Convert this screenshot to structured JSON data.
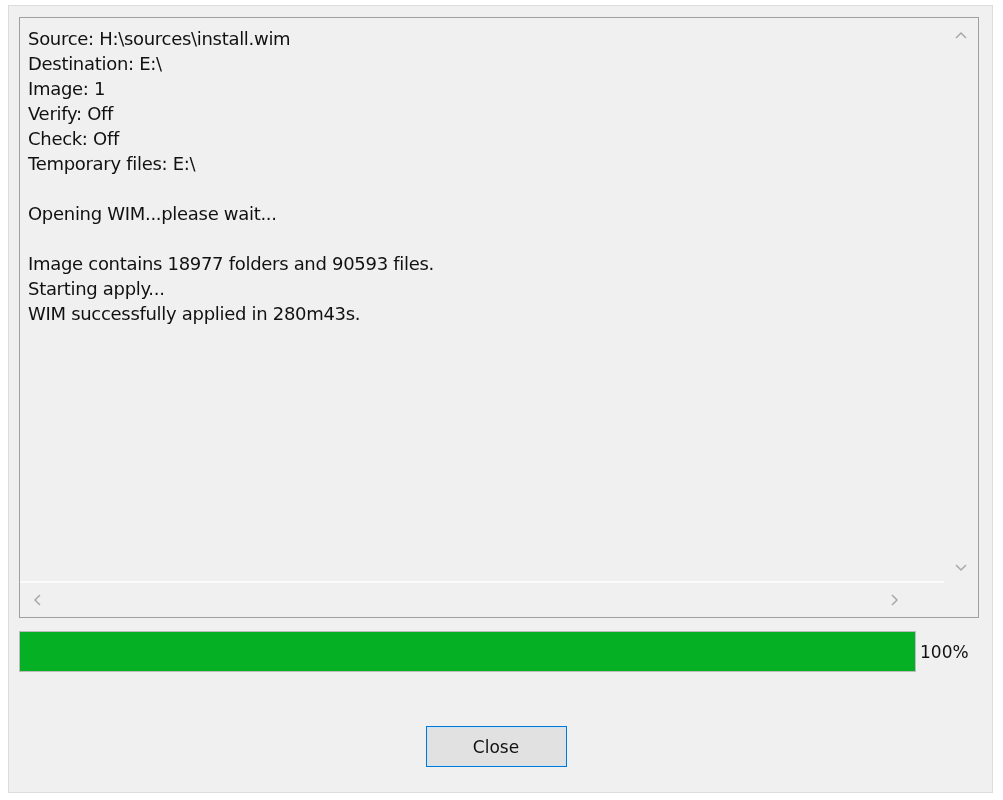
{
  "log": {
    "groups": [
      [
        "Source: H:\\sources\\install.wim",
        "Destination: E:\\",
        "Image: 1",
        "Verify: Off",
        "Check: Off",
        "Temporary files: E:\\"
      ],
      [
        "Opening WIM...please wait..."
      ],
      [
        "Image contains 18977 folders and 90593 files.",
        "Starting apply...",
        "WIM successfully applied in 280m43s."
      ]
    ]
  },
  "progress": {
    "level": 1,
    "reading": "100%"
  },
  "buttons": [
    {
      "label": "Close"
    }
  ]
}
